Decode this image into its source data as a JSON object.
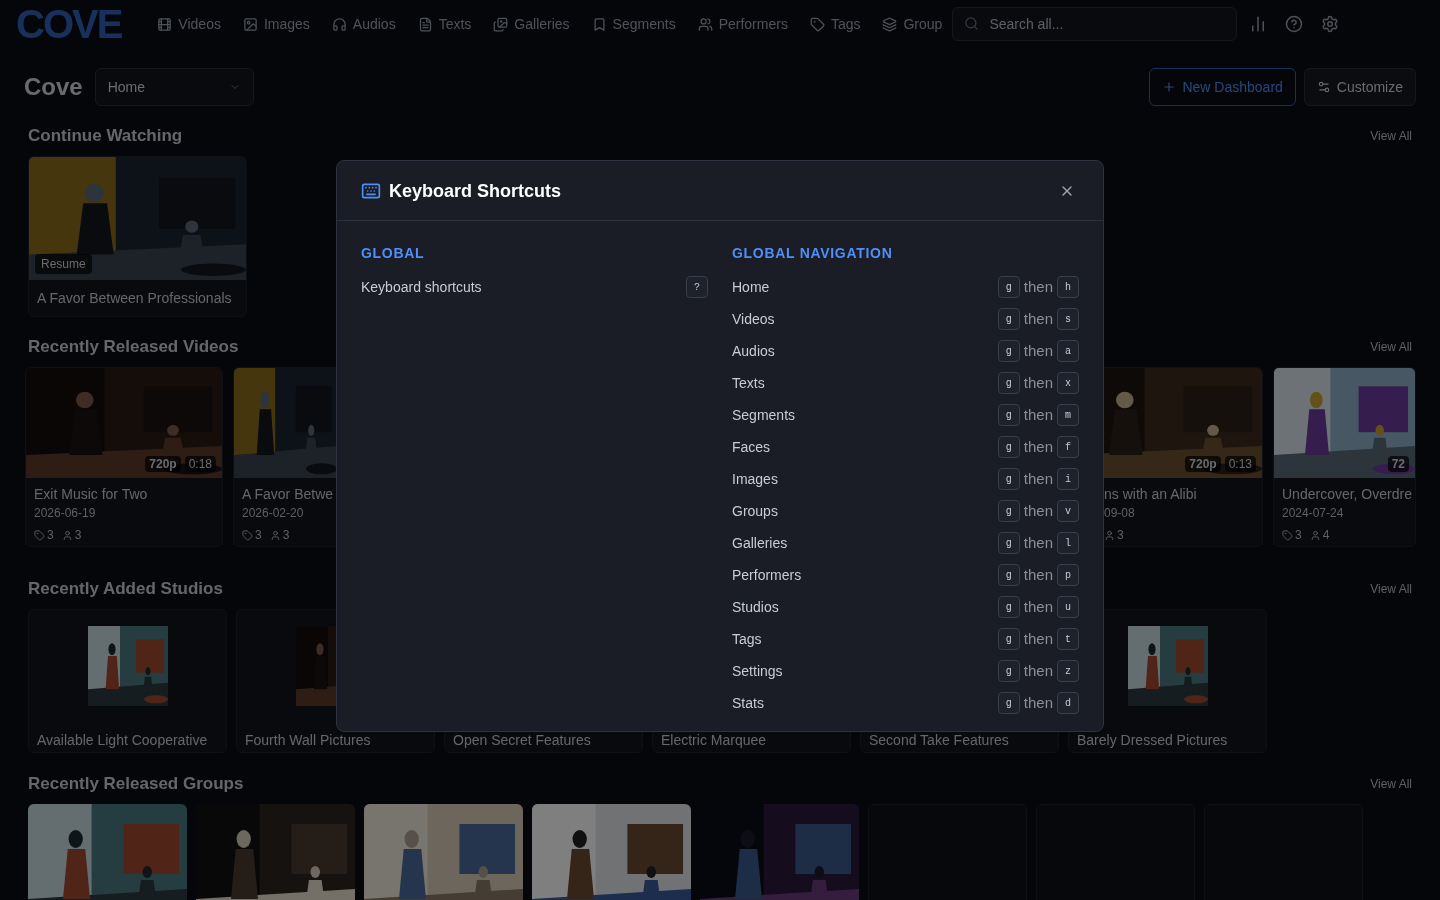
{
  "nav": {
    "logo": "COVE",
    "items": [
      {
        "label": "Videos"
      },
      {
        "label": "Images"
      },
      {
        "label": "Audios"
      },
      {
        "label": "Texts"
      },
      {
        "label": "Galleries"
      },
      {
        "label": "Segments"
      },
      {
        "label": "Performers"
      },
      {
        "label": "Tags"
      },
      {
        "label": "Group"
      }
    ],
    "search": {
      "placeholder": "Search all..."
    }
  },
  "header": {
    "title": "Cove",
    "select": {
      "value": "Home"
    },
    "buttons": [
      {
        "label": "New Dashboard",
        "kind": "primary"
      },
      {
        "label": "Customize",
        "kind": "secondary"
      }
    ]
  },
  "sections": [
    {
      "kind": "continue",
      "title": "Continue Watching",
      "view_all": "View All",
      "items": [
        {
          "title": "A Favor Between Professionals",
          "badge": "Resume"
        }
      ]
    },
    {
      "kind": "videos",
      "title": "Recently Released Videos",
      "view_all": "View All",
      "items": [
        {
          "title": "Exit Music for Two",
          "date": "2026-06-19",
          "tags": "3",
          "performers": "3",
          "resolution": "720p",
          "duration": "0:18"
        },
        {
          "title": "A Favor Betwe",
          "date": "2026-02-20",
          "tags": "3",
          "performers": "3"
        },
        {
          "title": "ns with an Alibi",
          "date": "09-08",
          "performers": "3",
          "resolution": "720p",
          "duration": "0:13"
        },
        {
          "title": "Undercover, Overdre",
          "date": "2024-07-24",
          "tags": "3",
          "performers": "4",
          "resolution": "72"
        }
      ]
    },
    {
      "kind": "studios",
      "title": "Recently Added Studios",
      "view_all": "View All",
      "items": [
        {
          "name": "Available Light Cooperative",
          "logo": {
            "kind": "picture"
          }
        },
        {
          "name": "Fourth Wall Pictures",
          "logo": {
            "kind": "picture"
          }
        },
        {
          "name": "Open Secret Features"
        },
        {
          "name": "Electric Marquee"
        },
        {
          "name": "Second Take Features"
        },
        {
          "name": "Barely Dressed Pictures",
          "logo": {
            "kind": "picture"
          }
        }
      ]
    },
    {
      "kind": "groups",
      "title": "Recently Released Groups",
      "view_all": "View All",
      "items": [
        {
          "kind": "picture"
        },
        {
          "kind": "picture"
        },
        {
          "kind": "picture"
        },
        {
          "kind": "picture"
        },
        {
          "kind": "picture"
        },
        {
          "kind": "empty"
        },
        {
          "kind": "empty"
        },
        {
          "kind": "empty"
        }
      ]
    }
  ],
  "dialog": {
    "title": "Keyboard Shortcuts",
    "groups": [
      {
        "heading": "GLOBAL",
        "shortcuts": [
          {
            "label": "Keyboard shortcuts",
            "keys": [
              {
                "kind": "key",
                "text": "?"
              }
            ]
          }
        ]
      },
      {
        "heading": "GLOBAL NAVIGATION",
        "shortcuts": [
          {
            "label": "Home",
            "keys": [
              {
                "kind": "key",
                "text": "g"
              },
              {
                "kind": "word",
                "text": "then"
              },
              {
                "kind": "key",
                "text": "h"
              }
            ]
          },
          {
            "label": "Videos",
            "keys": [
              {
                "kind": "key",
                "text": "g"
              },
              {
                "kind": "word",
                "text": "then"
              },
              {
                "kind": "key",
                "text": "s"
              }
            ]
          },
          {
            "label": "Audios",
            "keys": [
              {
                "kind": "key",
                "text": "g"
              },
              {
                "kind": "word",
                "text": "then"
              },
              {
                "kind": "key",
                "text": "a"
              }
            ]
          },
          {
            "label": "Texts",
            "keys": [
              {
                "kind": "key",
                "text": "g"
              },
              {
                "kind": "word",
                "text": "then"
              },
              {
                "kind": "key",
                "text": "x"
              }
            ]
          },
          {
            "label": "Segments",
            "keys": [
              {
                "kind": "key",
                "text": "g"
              },
              {
                "kind": "word",
                "text": "then"
              },
              {
                "kind": "key",
                "text": "m"
              }
            ]
          },
          {
            "label": "Faces",
            "keys": [
              {
                "kind": "key",
                "text": "g"
              },
              {
                "kind": "word",
                "text": "then"
              },
              {
                "kind": "key",
                "text": "f"
              }
            ]
          },
          {
            "label": "Images",
            "keys": [
              {
                "kind": "key",
                "text": "g"
              },
              {
                "kind": "word",
                "text": "then"
              },
              {
                "kind": "key",
                "text": "i"
              }
            ]
          },
          {
            "label": "Groups",
            "keys": [
              {
                "kind": "key",
                "text": "g"
              },
              {
                "kind": "word",
                "text": "then"
              },
              {
                "kind": "key",
                "text": "v"
              }
            ]
          },
          {
            "label": "Galleries",
            "keys": [
              {
                "kind": "key",
                "text": "g"
              },
              {
                "kind": "word",
                "text": "then"
              },
              {
                "kind": "key",
                "text": "l"
              }
            ]
          },
          {
            "label": "Performers",
            "keys": [
              {
                "kind": "key",
                "text": "g"
              },
              {
                "kind": "word",
                "text": "then"
              },
              {
                "kind": "key",
                "text": "p"
              }
            ]
          },
          {
            "label": "Studios",
            "keys": [
              {
                "kind": "key",
                "text": "g"
              },
              {
                "kind": "word",
                "text": "then"
              },
              {
                "kind": "key",
                "text": "u"
              }
            ]
          },
          {
            "label": "Tags",
            "keys": [
              {
                "kind": "key",
                "text": "g"
              },
              {
                "kind": "word",
                "text": "then"
              },
              {
                "kind": "key",
                "text": "t"
              }
            ]
          },
          {
            "label": "Settings",
            "keys": [
              {
                "kind": "key",
                "text": "g"
              },
              {
                "kind": "word",
                "text": "then"
              },
              {
                "kind": "key",
                "text": "z"
              }
            ]
          },
          {
            "label": "Stats",
            "keys": [
              {
                "kind": "key",
                "text": "g"
              },
              {
                "kind": "word",
                "text": "then"
              },
              {
                "kind": "key",
                "text": "d"
              }
            ]
          }
        ]
      }
    ]
  }
}
